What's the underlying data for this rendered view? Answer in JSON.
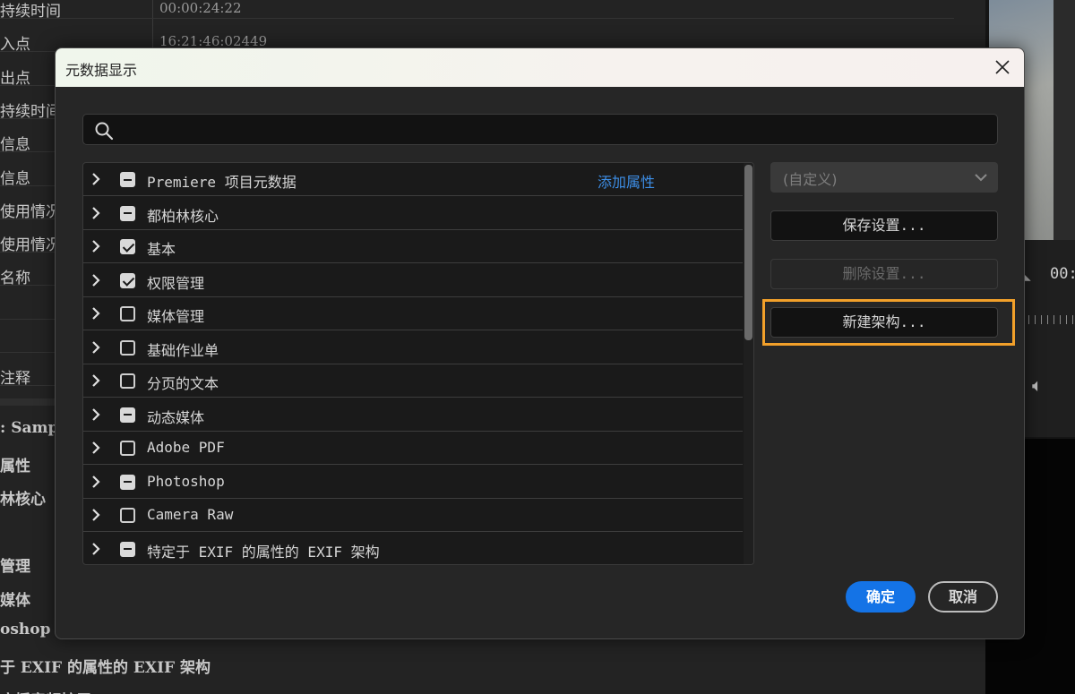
{
  "background": {
    "rows": [
      {
        "label": "持续时间",
        "value": "00:00:24:22"
      },
      {
        "label": "入点",
        "value": "16:21:46:02449"
      },
      {
        "label": "出点",
        "value": ""
      },
      {
        "label": "持续时间",
        "value": ""
      },
      {
        "label": "信息",
        "value": ""
      },
      {
        "label": "信息",
        "value": ""
      },
      {
        "label": "使用情况",
        "value": ""
      },
      {
        "label": "使用情况",
        "value": ""
      },
      {
        "label": "名称",
        "value": ""
      },
      {
        "label": "",
        "value": ""
      },
      {
        "label": "",
        "value": ""
      },
      {
        "label": "注释",
        "value": ""
      }
    ],
    "lower_rows": [
      ": Sample",
      "属性",
      "林核心",
      "",
      "管理",
      "媒体",
      "oshop",
      "于 EXIF 的属性的 EXIF 架构",
      "广播音频扩展 (bext)"
    ],
    "player_timecode": "00:"
  },
  "dialog": {
    "title": "元数据显示",
    "search_placeholder": "",
    "add_property_label": "添加属性",
    "schemas": [
      {
        "label": "Premiere 项目元数据",
        "state": "mixed"
      },
      {
        "label": "都柏林核心",
        "state": "mixed"
      },
      {
        "label": "基本",
        "state": "checked"
      },
      {
        "label": "权限管理",
        "state": "checked"
      },
      {
        "label": "媒体管理",
        "state": "unchecked"
      },
      {
        "label": "基础作业单",
        "state": "unchecked"
      },
      {
        "label": "分页的文本",
        "state": "unchecked"
      },
      {
        "label": "动态媒体",
        "state": "mixed"
      },
      {
        "label": "Adobe PDF",
        "state": "unchecked"
      },
      {
        "label": "Photoshop",
        "state": "mixed"
      },
      {
        "label": "Camera Raw",
        "state": "unchecked"
      },
      {
        "label": "特定于 EXIF 的属性的 EXIF 架构",
        "state": "mixed"
      }
    ],
    "preset_value": "(自定义)",
    "save_settings_label": "保存设置...",
    "delete_settings_label": "删除设置...",
    "new_schema_label": "新建架构...",
    "ok_label": "确定",
    "cancel_label": "取消"
  },
  "colors": {
    "accent": "#1473e6",
    "link": "#3d8ee6",
    "highlight": "#f2a02a"
  }
}
